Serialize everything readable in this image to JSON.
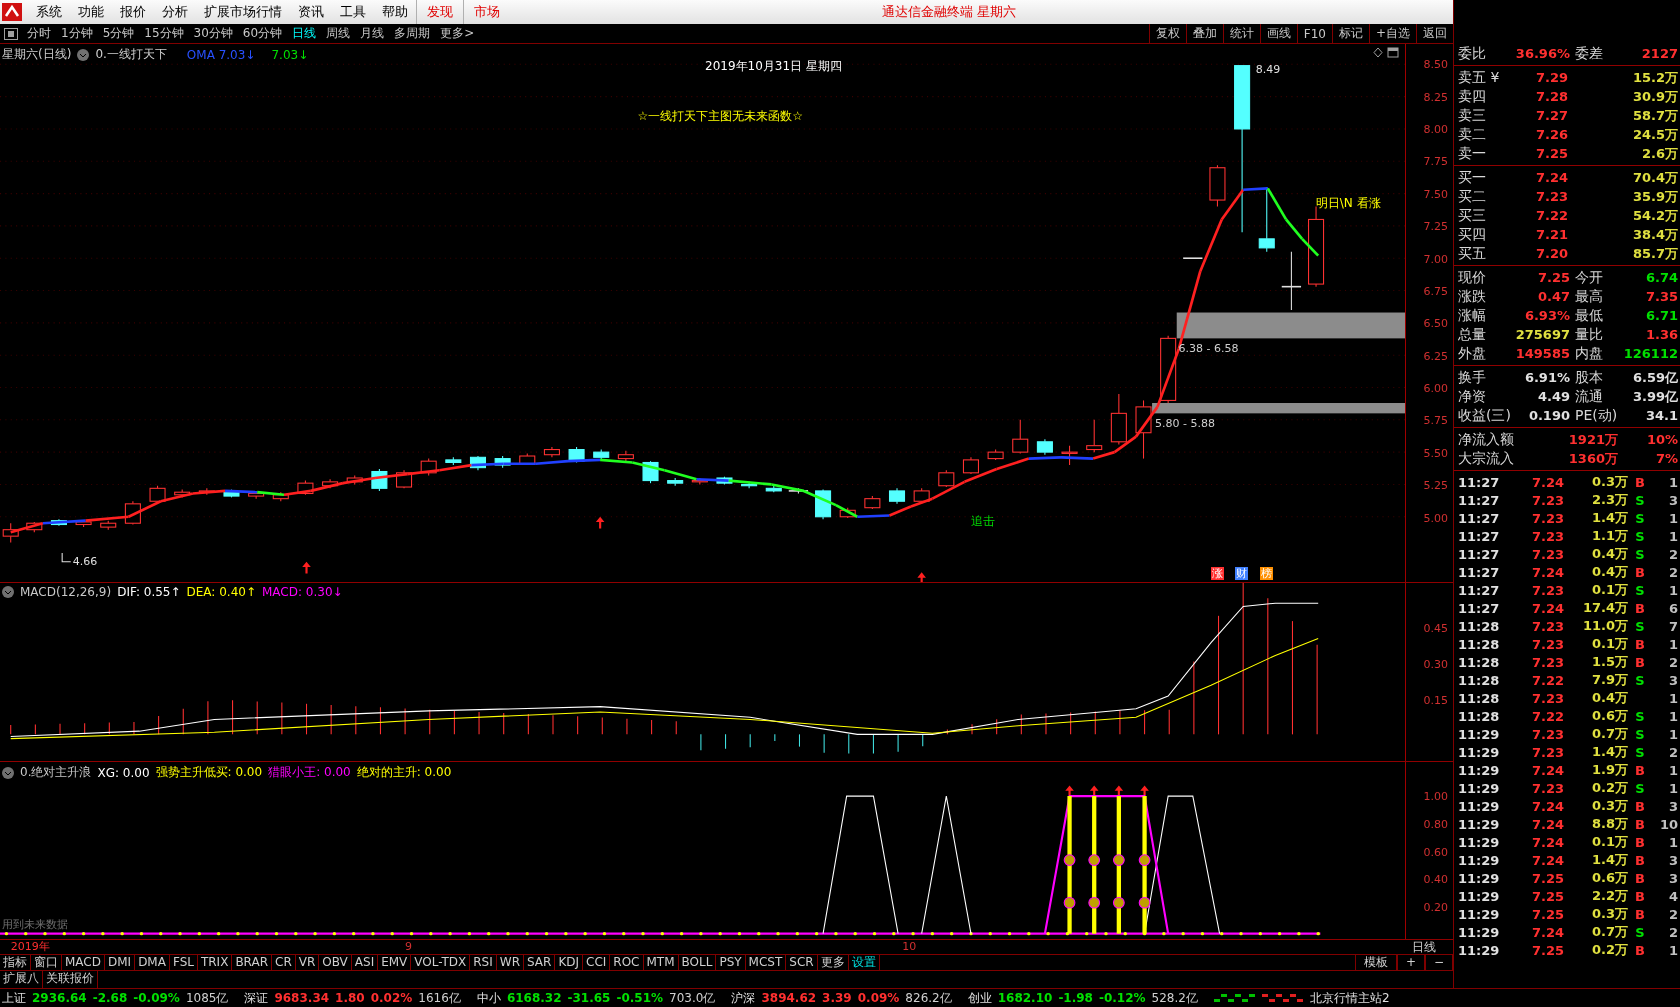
{
  "menubar": {
    "items": [
      "系统",
      "功能",
      "报价",
      "分析",
      "扩展市场行情",
      "资讯",
      "工具",
      "帮助"
    ],
    "highlight_items": [
      "发现",
      "市场"
    ],
    "title": "通达信金融终端 星期六"
  },
  "toolbar": {
    "periods": [
      {
        "label": "分时",
        "selected": false
      },
      {
        "label": "1分钟",
        "selected": false
      },
      {
        "label": "5分钟",
        "selected": false
      },
      {
        "label": "15分钟",
        "selected": false
      },
      {
        "label": "30分钟",
        "selected": false
      },
      {
        "label": "60分钟",
        "selected": false
      },
      {
        "label": "日线",
        "selected": true
      },
      {
        "label": "周线",
        "selected": false
      },
      {
        "label": "月线",
        "selected": false
      },
      {
        "label": "多周期",
        "selected": false
      },
      {
        "label": "更多>",
        "selected": false
      }
    ],
    "actions": [
      "复权",
      "叠加",
      "统计",
      "画线",
      "F10",
      "标记",
      "+自选",
      "返回"
    ]
  },
  "main_chart": {
    "header": {
      "period": "星期六(日线)",
      "formula": "0.一线打天下",
      "values": [
        {
          "text": "OMA 7.03↓",
          "color": "#2850ff"
        },
        {
          "text": "7.03↓",
          "color": "#00e000"
        }
      ]
    },
    "date_title": "2019年10月31日 星期四",
    "banner": "☆一线打天下主图无未来函数☆",
    "forecast": "明日\\N 看涨",
    "signal": "追击",
    "high_label": "8.49",
    "low_label": "4.66",
    "zones": [
      {
        "label": "6.38 - 6.58"
      },
      {
        "label": "5.80 - 5.88"
      }
    ],
    "badges": [
      {
        "text": "涨",
        "color": "#ff3030"
      },
      {
        "text": "财",
        "color": "#4080ff"
      },
      {
        "text": "榜",
        "color": "#ff9000"
      }
    ],
    "price_axis": [
      "8.50",
      "8.25",
      "8.00",
      "7.75",
      "7.50",
      "7.25",
      "7.00",
      "6.75",
      "6.50",
      "6.25",
      "6.00",
      "5.75",
      "5.50",
      "5.25",
      "5.00"
    ]
  },
  "macd_chart": {
    "header": [
      {
        "text": "MACD(12,26,9)",
        "color": "#c8c8c8"
      },
      {
        "text": "DIF: 0.55↑",
        "color": "#ffffff"
      },
      {
        "text": "DEA: 0.40↑",
        "color": "#ffff00"
      },
      {
        "text": "MACD: 0.30↓",
        "color": "#ff00ff"
      }
    ],
    "axis": [
      "0.45",
      "0.30",
      "0.15"
    ]
  },
  "signal_chart": {
    "header": [
      {
        "text": "0.绝对主升浪",
        "color": "#c8c8c8"
      },
      {
        "text": "XG: 0.00",
        "color": "#ffffff"
      },
      {
        "text": "强势主升低买: 0.00",
        "color": "#ffff00"
      },
      {
        "text": "猎眼小王: 0.00",
        "color": "#ff00ff"
      },
      {
        "text": "绝对的主升: 0.00",
        "color": "#ffff00"
      }
    ],
    "axis": [
      "1.00",
      "0.80",
      "0.60",
      "0.40",
      "0.20"
    ],
    "note": "用到未来数据"
  },
  "date_axis": {
    "labels": [
      "2019年",
      "9",
      "10"
    ],
    "period": "日线"
  },
  "indicator_tabs": [
    {
      "label": "指标",
      "kind": "tab"
    },
    {
      "label": "窗口",
      "kind": "tab"
    },
    {
      "label": "MACD",
      "kind": "tab"
    },
    {
      "label": "DMI",
      "kind": "tab"
    },
    {
      "label": "DMA",
      "kind": "tab"
    },
    {
      "label": "FSL",
      "kind": "tab"
    },
    {
      "label": "TRIX",
      "kind": "tab"
    },
    {
      "label": "BRAR",
      "kind": "tab"
    },
    {
      "label": "CR",
      "kind": "tab"
    },
    {
      "label": "VR",
      "kind": "tab"
    },
    {
      "label": "OBV",
      "kind": "tab"
    },
    {
      "label": "ASI",
      "kind": "tab"
    },
    {
      "label": "EMV",
      "kind": "tab"
    },
    {
      "label": "VOL-TDX",
      "kind": "tab"
    },
    {
      "label": "RSI",
      "kind": "tab"
    },
    {
      "label": "WR",
      "kind": "tab"
    },
    {
      "label": "SAR",
      "kind": "tab"
    },
    {
      "label": "KDJ",
      "kind": "tab"
    },
    {
      "label": "CCI",
      "kind": "tab"
    },
    {
      "label": "ROC",
      "kind": "tab"
    },
    {
      "label": "MTM",
      "kind": "tab"
    },
    {
      "label": "BOLL",
      "kind": "tab"
    },
    {
      "label": "PSY",
      "kind": "tab"
    },
    {
      "label": "MCST",
      "kind": "tab"
    },
    {
      "label": "SCR",
      "kind": "tab"
    },
    {
      "label": "更多",
      "kind": "tab"
    },
    {
      "label": "设置",
      "kind": "setting"
    }
  ],
  "tab_tools": [
    "模板",
    "+",
    "−"
  ],
  "extension_tabs": [
    "扩展八",
    "关联报价"
  ],
  "quote": {
    "ratio": [
      {
        "label": "委比",
        "value": "36.96%",
        "color": "#ff3030"
      },
      {
        "label": "委差",
        "value": "2127",
        "color": "#ff3030"
      }
    ],
    "asks": [
      {
        "label": "卖五 ¥",
        "price": "7.29",
        "volume": "15.2万"
      },
      {
        "label": "卖四",
        "price": "7.28",
        "volume": "30.9万"
      },
      {
        "label": "卖三",
        "price": "7.27",
        "volume": "58.7万"
      },
      {
        "label": "卖二",
        "price": "7.26",
        "volume": "24.5万"
      },
      {
        "label": "卖一",
        "price": "7.25",
        "volume": "2.6万"
      }
    ],
    "bids": [
      {
        "label": "买一",
        "price": "7.24",
        "volume": "70.4万"
      },
      {
        "label": "买二",
        "price": "7.23",
        "volume": "35.9万"
      },
      {
        "label": "买三",
        "price": "7.22",
        "volume": "54.2万"
      },
      {
        "label": "买四",
        "price": "7.21",
        "volume": "38.4万"
      },
      {
        "label": "买五",
        "price": "7.20",
        "volume": "85.7万"
      }
    ],
    "stats": [
      [
        {
          "label": "现价",
          "value": "7.25",
          "color": "#ff3030"
        },
        {
          "label": "今开",
          "value": "6.74",
          "color": "#00e000"
        }
      ],
      [
        {
          "label": "涨跌",
          "value": "0.47",
          "color": "#ff3030"
        },
        {
          "label": "最高",
          "value": "7.35",
          "color": "#ff3030"
        }
      ],
      [
        {
          "label": "涨幅",
          "value": "6.93%",
          "color": "#ff3030"
        },
        {
          "label": "最低",
          "value": "6.71",
          "color": "#00e000"
        }
      ],
      [
        {
          "label": "总量",
          "value": "275697",
          "color": "#e0e040"
        },
        {
          "label": "量比",
          "value": "1.36",
          "color": "#ff3030"
        }
      ],
      [
        {
          "label": "外盘",
          "value": "149585",
          "color": "#ff3030"
        },
        {
          "label": "内盘",
          "value": "126112",
          "color": "#00e000"
        }
      ]
    ],
    "fundamentals": [
      [
        {
          "label": "换手",
          "value": "6.91%"
        },
        {
          "label": "股本",
          "value": "6.59亿"
        }
      ],
      [
        {
          "label": "净资",
          "value": "4.49"
        },
        {
          "label": "流通",
          "value": "3.99亿"
        }
      ],
      [
        {
          "label": "收益(三)",
          "value": "0.190"
        },
        {
          "label": "PE(动)",
          "value": "34.1"
        }
      ]
    ],
    "flows": [
      {
        "label": "净流入额",
        "amount": "1921万",
        "percent": "10%"
      },
      {
        "label": "大宗流入",
        "amount": "1360万",
        "percent": "7%"
      }
    ]
  },
  "trades": [
    {
      "time": "11:27",
      "price": "7.24",
      "volume": "0.3万",
      "side": "B",
      "count": "1"
    },
    {
      "time": "11:27",
      "price": "7.23",
      "volume": "2.3万",
      "side": "S",
      "count": "3"
    },
    {
      "time": "11:27",
      "price": "7.23",
      "volume": "1.4万",
      "side": "S",
      "count": "1"
    },
    {
      "time": "11:27",
      "price": "7.23",
      "volume": "1.1万",
      "side": "S",
      "count": "1"
    },
    {
      "time": "11:27",
      "price": "7.23",
      "volume": "0.4万",
      "side": "S",
      "count": "2"
    },
    {
      "time": "11:27",
      "price": "7.24",
      "volume": "0.4万",
      "side": "B",
      "count": "2"
    },
    {
      "time": "11:27",
      "price": "7.23",
      "volume": "0.1万",
      "side": "S",
      "count": "1"
    },
    {
      "time": "11:27",
      "price": "7.24",
      "volume": "17.4万",
      "side": "B",
      "count": "6"
    },
    {
      "time": "11:28",
      "price": "7.23",
      "volume": "11.0万",
      "side": "S",
      "count": "7"
    },
    {
      "time": "11:28",
      "price": "7.23",
      "volume": "0.1万",
      "side": "B",
      "count": "1"
    },
    {
      "time": "11:28",
      "price": "7.23",
      "volume": "1.5万",
      "side": "B",
      "count": "2"
    },
    {
      "time": "11:28",
      "price": "7.22",
      "volume": "7.9万",
      "side": "S",
      "count": "3"
    },
    {
      "time": "11:28",
      "price": "7.23",
      "volume": "0.4万",
      "count": "1"
    },
    {
      "time": "11:28",
      "price": "7.22",
      "volume": "0.6万",
      "side": "S",
      "count": "1"
    },
    {
      "time": "11:29",
      "price": "7.23",
      "volume": "0.7万",
      "side": "S",
      "count": "1"
    },
    {
      "time": "11:29",
      "price": "7.23",
      "volume": "1.4万",
      "side": "S",
      "count": "2"
    },
    {
      "time": "11:29",
      "price": "7.24",
      "volume": "1.9万",
      "side": "B",
      "count": "1"
    },
    {
      "time": "11:29",
      "price": "7.23",
      "volume": "0.2万",
      "side": "S",
      "count": "1"
    },
    {
      "time": "11:29",
      "price": "7.24",
      "volume": "0.3万",
      "side": "B",
      "count": "3"
    },
    {
      "time": "11:29",
      "price": "7.24",
      "volume": "8.8万",
      "side": "B",
      "count": "10"
    },
    {
      "time": "11:29",
      "price": "7.24",
      "volume": "0.1万",
      "side": "B",
      "count": "1"
    },
    {
      "time": "11:29",
      "price": "7.24",
      "volume": "1.4万",
      "side": "B",
      "count": "3"
    },
    {
      "time": "11:29",
      "price": "7.25",
      "volume": "0.6万",
      "side": "B",
      "count": "3"
    },
    {
      "time": "11:29",
      "price": "7.25",
      "volume": "2.2万",
      "side": "B",
      "count": "4"
    },
    {
      "time": "11:29",
      "price": "7.25",
      "volume": "0.3万",
      "side": "B",
      "count": "2"
    },
    {
      "time": "11:29",
      "price": "7.24",
      "volume": "0.7万",
      "side": "S",
      "count": "2"
    },
    {
      "time": "11:29",
      "price": "7.25",
      "volume": "0.2万",
      "side": "B",
      "count": "1"
    }
  ],
  "status_bar": {
    "indices": [
      {
        "name": "上证",
        "value": "2936.64",
        "change": "-2.68",
        "percent": "-0.09%",
        "amount": "1085亿",
        "color": "#00e000"
      },
      {
        "name": "深证",
        "value": "9683.34",
        "change": "1.80",
        "percent": "0.02%",
        "amount": "1616亿",
        "color": "#ff3030"
      },
      {
        "name": "中小",
        "value": "6168.32",
        "change": "-31.65",
        "percent": "-0.51%",
        "amount": "703.0亿",
        "color": "#00e000"
      },
      {
        "name": "沪深",
        "value": "3894.62",
        "change": "3.39",
        "percent": "0.09%",
        "amount": "826.2亿",
        "color": "#ff3030"
      },
      {
        "name": "创业",
        "value": "1682.10",
        "change": "-1.98",
        "percent": "-0.12%",
        "amount": "528.2亿",
        "color": "#00e000"
      }
    ],
    "server": "北京行情主站2"
  }
}
